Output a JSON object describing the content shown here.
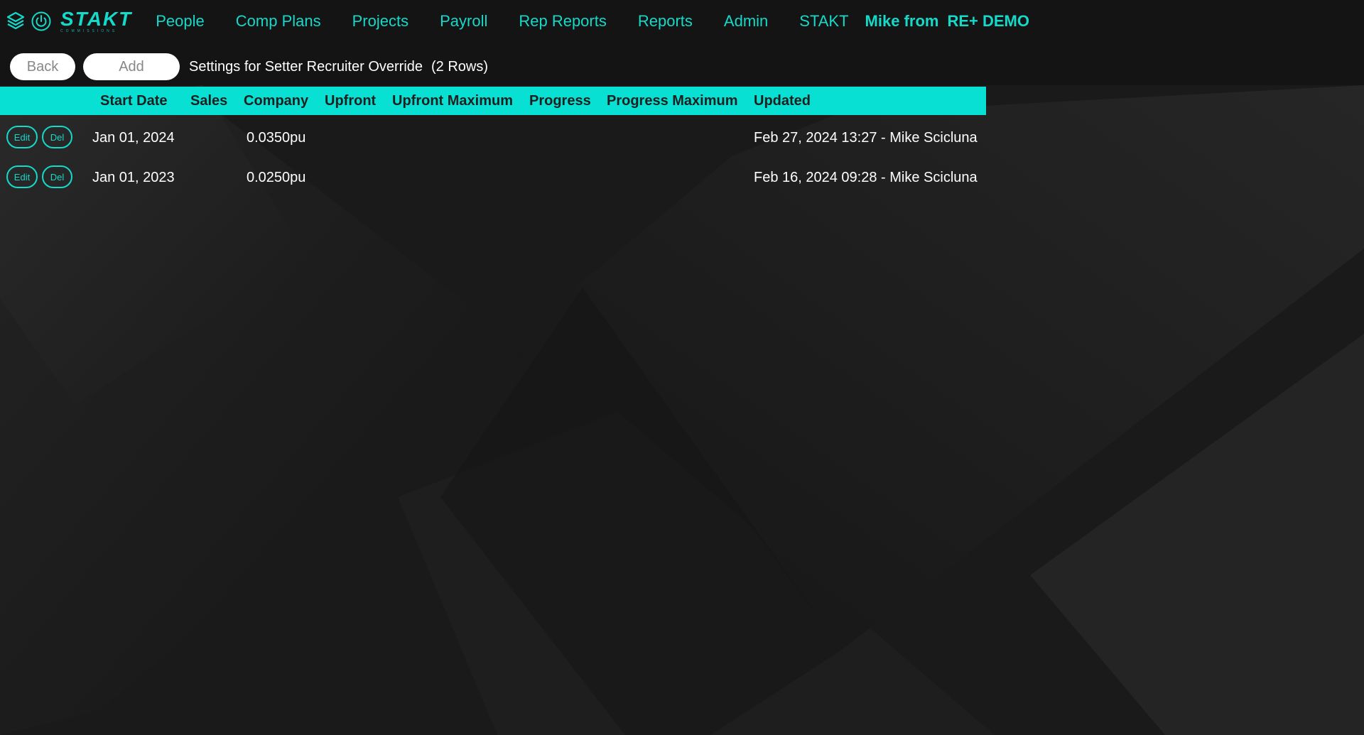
{
  "app": {
    "brand": "STAKT",
    "brand_sub": "COMMISSIONS"
  },
  "nav": {
    "items": [
      "People",
      "Comp Plans",
      "Projects",
      "Payroll",
      "Rep Reports",
      "Reports",
      "Admin",
      "STAKT"
    ],
    "user": "Mike from",
    "org": "RE+ DEMO"
  },
  "toolbar": {
    "back_label": "Back",
    "add_label": "Add",
    "title": "Settings for Setter Recruiter Override",
    "row_count": "(2 Rows)"
  },
  "table": {
    "columns": [
      "Start Date",
      "Sales",
      "Company",
      "Upfront",
      "Upfront Maximum",
      "Progress",
      "Progress Maximum",
      "Updated"
    ],
    "rows": [
      {
        "edit_label": "Edit",
        "del_label": "Del",
        "start_date": "Jan 01, 2024",
        "sales": "",
        "company": "0.0350pu",
        "upfront": "",
        "upfront_max": "",
        "progress": "",
        "progress_max": "",
        "updated": "Feb 27, 2024 13:27 - Mike Scicluna"
      },
      {
        "edit_label": "Edit",
        "del_label": "Del",
        "start_date": "Jan 01, 2023",
        "sales": "",
        "company": "0.0250pu",
        "upfront": "",
        "upfront_max": "",
        "progress": "",
        "progress_max": "",
        "updated": "Feb 16, 2024 09:28 - Mike Scicluna"
      }
    ]
  },
  "colors": {
    "accent": "#15d9c9",
    "header_bg": "#07e0d2",
    "page_bg": "#1c1c1c"
  },
  "icons": [
    "layers-icon",
    "power-icon"
  ]
}
